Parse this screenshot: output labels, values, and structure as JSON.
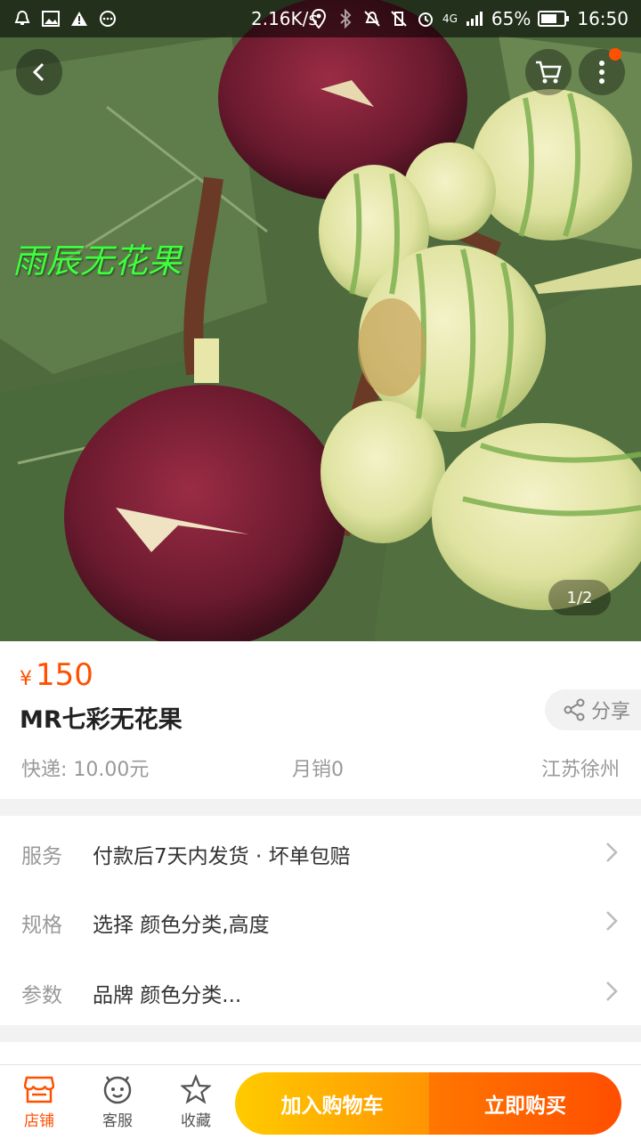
{
  "status_bar": {
    "speed": "2.16K/s",
    "network": "4G",
    "battery": "65%",
    "time": "16:50"
  },
  "hero": {
    "watermark": "雨辰无花果",
    "pager": "1/2"
  },
  "product": {
    "currency": "¥",
    "price": "150",
    "title": "MR七彩无花果",
    "share_label": "分享",
    "shipping": "快递: 10.00元",
    "monthly_sales": "月销0",
    "location": "江苏徐州"
  },
  "options": [
    {
      "label": "服务",
      "value": "付款后7天内发货 · 坏单包赔"
    },
    {
      "label": "规格",
      "value": "选择 颜色分类,高度"
    },
    {
      "label": "参数",
      "value": "品牌 颜色分类..."
    }
  ],
  "bottom_bar": {
    "store_label": "店铺",
    "service_label": "客服",
    "favorite_label": "收藏",
    "add_to_cart": "加入购物车",
    "buy_now": "立即购买"
  },
  "colors": {
    "accent": "#ff5000",
    "cart_button": "#ffb300",
    "buy_button": "#ff5a00"
  }
}
